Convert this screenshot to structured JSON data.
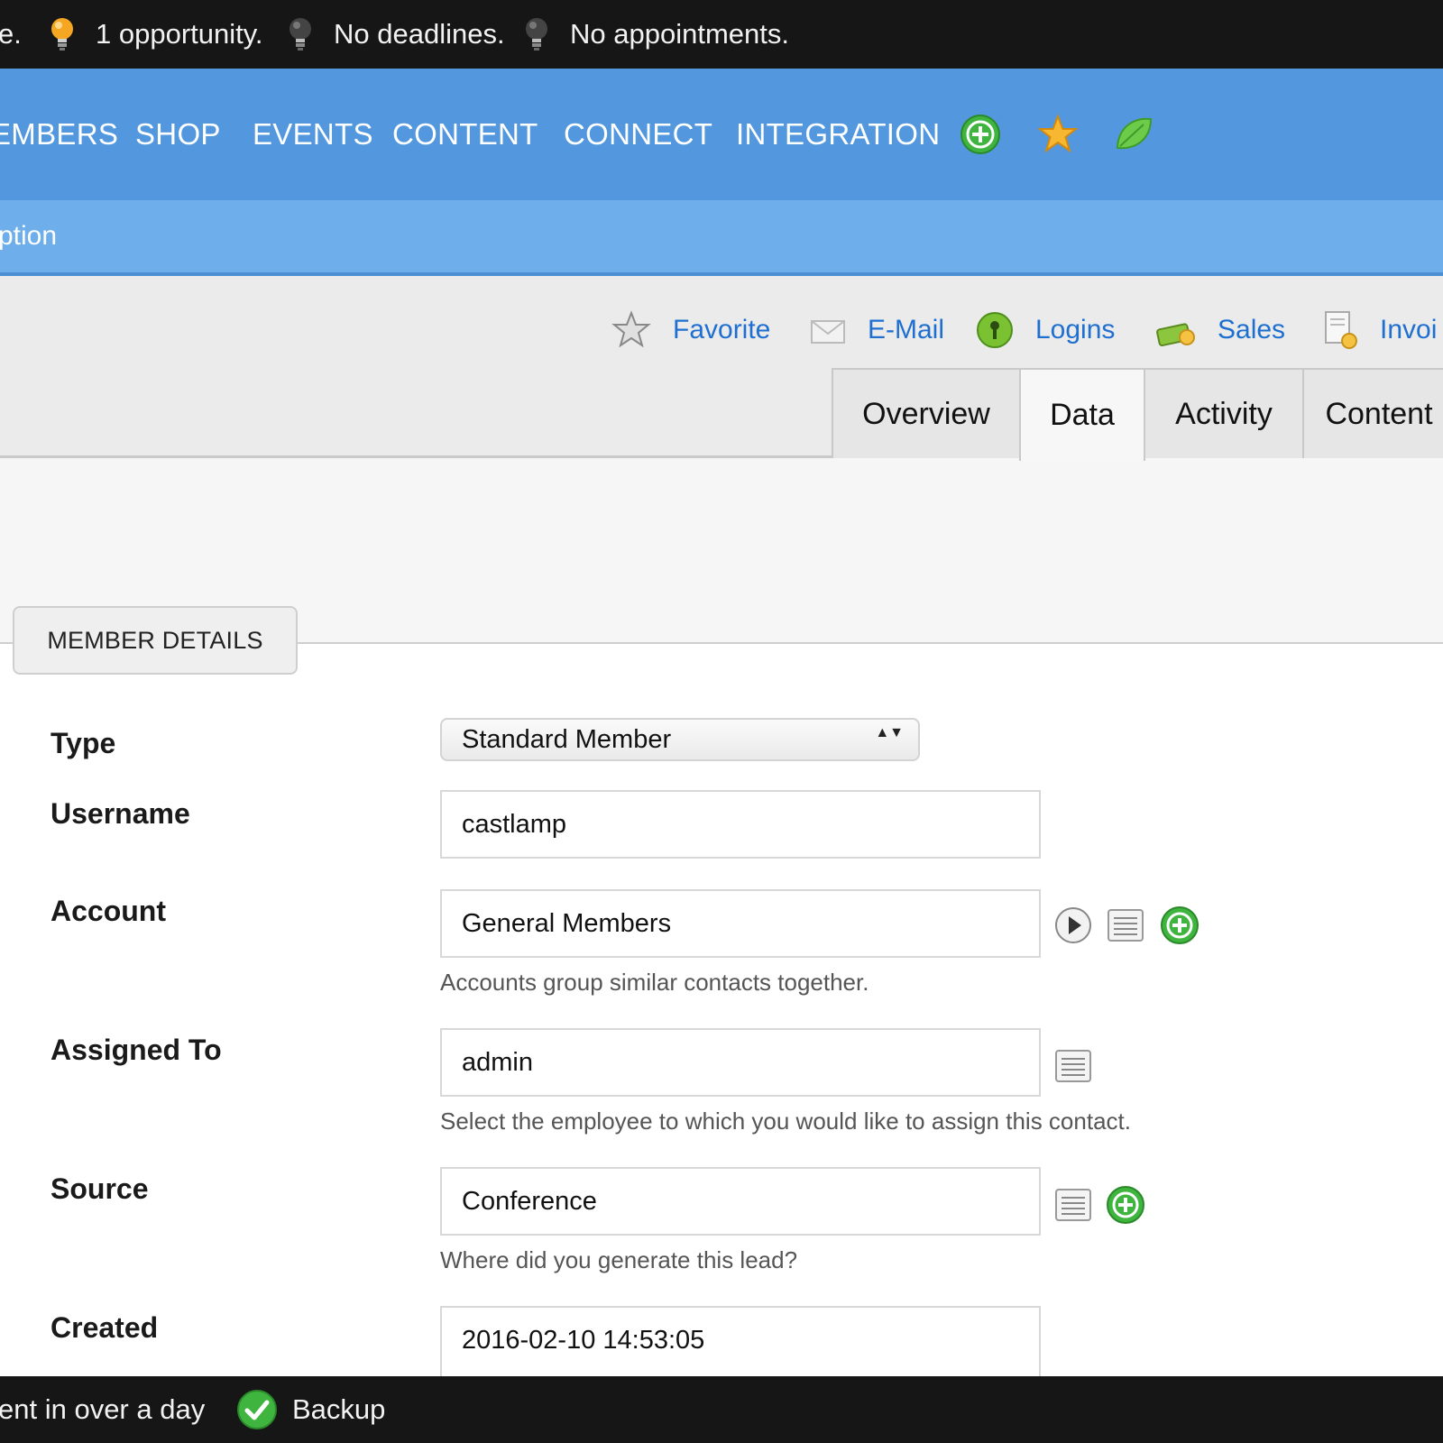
{
  "status_bar": {
    "truncated_prefix": "e.",
    "opportunities": "1 opportunity.",
    "deadlines": "No deadlines.",
    "appointments": "No appointments."
  },
  "nav": {
    "items": [
      "EMBERS",
      "SHOP",
      "EVENTS",
      "CONTENT",
      "CONNECT",
      "INTEGRATION"
    ],
    "icons": [
      "plus-circle-icon",
      "star-icon",
      "leaf-icon"
    ]
  },
  "subnav": {
    "label": "ption"
  },
  "actions": [
    "Favorite",
    "E-Mail",
    "Logins",
    "Sales",
    "Invoi"
  ],
  "tabs": [
    "Overview",
    "Data",
    "Activity",
    "Content"
  ],
  "active_tab": "Data",
  "section": {
    "title": "MEMBER DETAILS"
  },
  "form": {
    "type": {
      "label": "Type",
      "value": "Standard Member",
      "arrows": "▲▼"
    },
    "username": {
      "label": "Username",
      "value": "castlamp"
    },
    "account": {
      "label": "Account",
      "value": "General Members",
      "help": "Accounts group similar contacts together."
    },
    "assigned_to": {
      "label": "Assigned To",
      "value": "admin",
      "help": "Select the employee to which you would like to assign this contact."
    },
    "source": {
      "label": "Source",
      "value": "Conference",
      "help": "Where did you generate this lead?"
    },
    "created": {
      "label": "Created",
      "value": "2016-02-10 14:53:05"
    }
  },
  "bottom_bar": {
    "message": "ent in over a day",
    "backup": "Backup"
  },
  "colors": {
    "nav_blue": "#5398de",
    "subnav_blue": "#6eaeea",
    "link_blue": "#1f6fd1",
    "green": "#3fb53f",
    "dark_bar": "#161616"
  }
}
